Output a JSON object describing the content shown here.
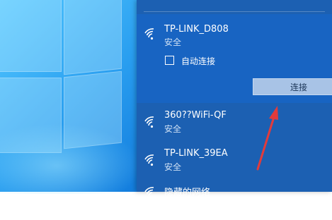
{
  "networks": [
    {
      "ssid": "TP-LINK_D808",
      "status": "安全",
      "icon": "wifi-icon",
      "selected": true
    },
    {
      "ssid": "360??WiFi-QF",
      "status": "安全",
      "icon": "wifi-icon",
      "selected": false
    },
    {
      "ssid": "TP-LINK_39EA",
      "status": "安全",
      "icon": "wifi-icon",
      "selected": false
    },
    {
      "ssid": "隐藏的网络",
      "status": "",
      "icon": "wifi-icon",
      "selected": false
    }
  ],
  "auto_connect": {
    "label": "自动连接",
    "checked": false
  },
  "connect_button": {
    "label": "连接"
  },
  "colors": {
    "flyout_bg": "#1c60b2",
    "selected_bg": "#1864c2",
    "button_bg": "#a8c3e6",
    "annotation_arrow": "#e23b3b"
  }
}
